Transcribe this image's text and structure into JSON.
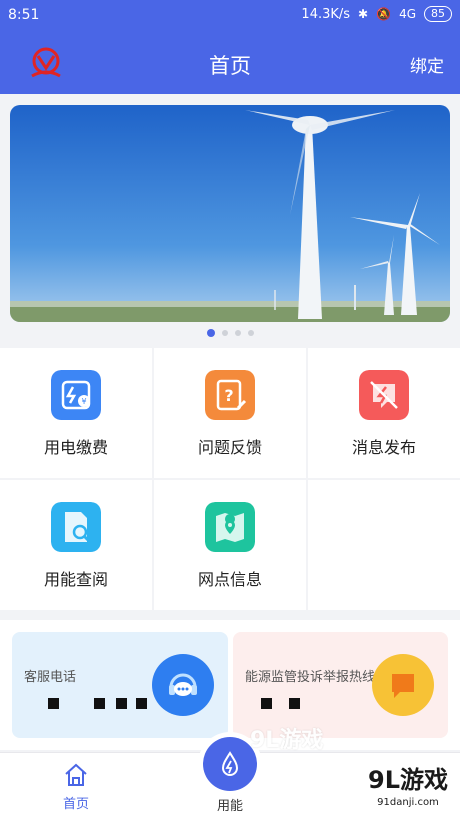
{
  "status_bar": {
    "time": "8:51",
    "speed": "14.3K/s",
    "network": "4G",
    "battery": "85"
  },
  "nav": {
    "title": "首页",
    "bind_label": "绑定"
  },
  "banner": {
    "slide_count": 4,
    "active_slide": 1
  },
  "menu": [
    {
      "label": "用电缴费",
      "icon": "power-bill-icon",
      "color": "#3d86f5"
    },
    {
      "label": "问题反馈",
      "icon": "feedback-icon",
      "color": "#f48a3b"
    },
    {
      "label": "消息发布",
      "icon": "message-icon",
      "color": "#f55a5a"
    },
    {
      "label": "用能查阅",
      "icon": "energy-lookup-icon",
      "color": "#2db2f0"
    },
    {
      "label": "网点信息",
      "icon": "map-pin-icon",
      "color": "#1ec49e"
    }
  ],
  "hotlines": [
    {
      "label": "客服电话",
      "icon": "headset-chat-icon",
      "color": "#2e7ef0"
    },
    {
      "label": "能源监管投诉举报热线",
      "icon": "chat-bubble-icon",
      "color": "#f7a81e"
    }
  ],
  "tabs": [
    {
      "label": "首页",
      "icon": "home-icon"
    },
    {
      "label": "用能",
      "icon": "energy-drop-icon"
    }
  ],
  "watermark": {
    "brand": "9L游戏",
    "site": "91danji.com"
  }
}
